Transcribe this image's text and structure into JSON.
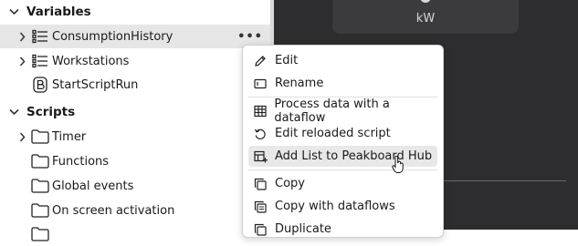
{
  "sidebar": {
    "sections": [
      {
        "label": "Variables",
        "expanded": true
      },
      {
        "label": "Scripts",
        "expanded": true
      }
    ],
    "variables": [
      {
        "label": "ConsumptionHistory",
        "icon": "list-icon",
        "expandable": true,
        "selected": true,
        "more": "•••"
      },
      {
        "label": "Workstations",
        "icon": "list-icon",
        "expandable": true
      },
      {
        "label": "StartScriptRun",
        "icon": "boolean-b-icon",
        "expandable": false
      }
    ],
    "scripts": [
      {
        "label": "Timer",
        "icon": "folder-icon",
        "expandable": true
      },
      {
        "label": "Functions",
        "icon": "folder-icon",
        "expandable": false
      },
      {
        "label": "Global events",
        "icon": "folder-icon",
        "expandable": false
      },
      {
        "label": "On screen activation",
        "icon": "folder-icon",
        "expandable": false
      }
    ]
  },
  "dashboard": {
    "unit_label": "kW"
  },
  "context_menu": {
    "groups": [
      [
        {
          "label": "Edit",
          "icon": "pencil-icon"
        },
        {
          "label": "Rename",
          "icon": "rename-icon"
        }
      ],
      [
        {
          "label": "Process data with a dataflow",
          "icon": "table-icon"
        },
        {
          "label": "Edit reloaded script",
          "icon": "reload-icon"
        },
        {
          "label": "Add List to Peakboard Hub",
          "icon": "hub-add-icon",
          "hover": true
        }
      ],
      [
        {
          "label": "Copy",
          "icon": "copy-icon"
        },
        {
          "label": "Copy with dataflows",
          "icon": "copy-dataflow-icon"
        },
        {
          "label": "Duplicate",
          "icon": "duplicate-icon"
        }
      ]
    ]
  }
}
